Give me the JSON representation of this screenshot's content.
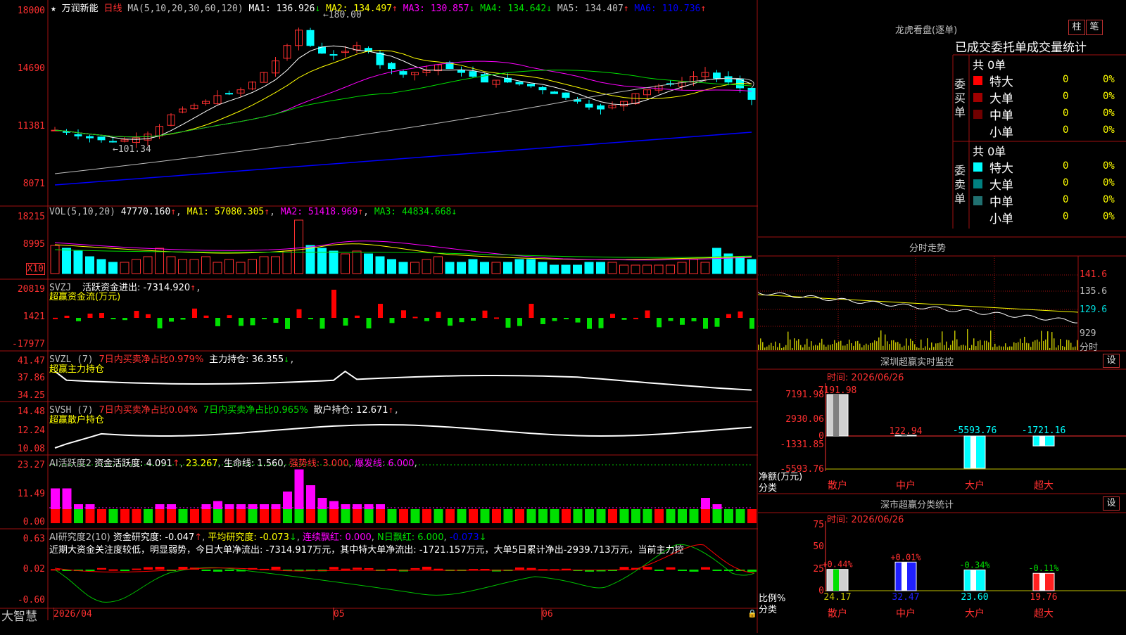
{
  "stock": {
    "name": "万润新能",
    "period": "日线",
    "star": "★",
    "arrow_up": "↑",
    "arrow_down": "↓"
  },
  "main_chart": {
    "ma_label": "MA(5,10,20,30,60,120)",
    "ma": [
      {
        "label": "MA1: 136.926",
        "arrow": "↓",
        "color": "#ffffff"
      },
      {
        "label": "MA2: 134.497",
        "arrow": "↑",
        "color": "#ffff00"
      },
      {
        "label": "MA3: 130.857",
        "arrow": "↓",
        "color": "#ff00ff"
      },
      {
        "label": "MA4: 134.642",
        "arrow": "↓",
        "color": "#00e000"
      },
      {
        "label": "MA5: 134.407",
        "arrow": "↑",
        "color": "#c0c0c0"
      },
      {
        "label": "MA6: 110.736",
        "arrow": "↑",
        "color": "#0000ff"
      }
    ],
    "y_ticks": [
      "18000",
      "14690",
      "11381",
      "8071"
    ],
    "high_marker": "180.00",
    "low_marker": "101.34"
  },
  "volume": {
    "label": "VOL(5,10,20)",
    "value": "47770.160",
    "ma1": "MA1: 57080.305",
    "ma2": "MA2: 51418.969",
    "ma3": "MA3: 44834.668",
    "y_ticks": [
      "18215",
      "8995"
    ],
    "unit": "X10"
  },
  "svzj": {
    "label": "SVZJ",
    "title": "活跃资金进出: -7314.920",
    "sub": "超赢资金流(万元)",
    "y_ticks": [
      "20819",
      "1421",
      "-17977"
    ]
  },
  "svzl": {
    "label": "SVZL (7)",
    "red": "7日内买卖净占比0.979%",
    "text": "主力持仓: 36.355",
    "sub": "超赢主力持仓",
    "y_ticks": [
      "41.47",
      "37.86",
      "34.25"
    ]
  },
  "svsh": {
    "label": "SVSH (7)",
    "red": "7日内买卖净占比0.04%",
    "green": "7日内买卖净占比0.965%",
    "text": "散户持仓: 12.671",
    "sub": "超赢散户持仓",
    "y_ticks": [
      "14.48",
      "12.24",
      "10.08"
    ]
  },
  "ai_active": {
    "label": "AI活跃度2",
    "t1": "资金活跃度: 4.091",
    "t2": "23.267",
    "t3": "生命线: 1.560",
    "t4": "强势线: 3.000",
    "t5": "爆发线: 6.000",
    "y_ticks": [
      "23.27",
      "11.49",
      "0.00"
    ]
  },
  "ai_research": {
    "label": "AI研究度2(10)",
    "t1": "资金研究度: -0.047",
    "t2": "平均研究度: -0.073",
    "t3": "连续飘红: 0.000",
    "t4": "N日飘红: 6.000",
    "t5": "-0.073",
    "comment": "近期大资金关注度较低，明显弱势，今日大单净流出: -7314.917万元，其中特大单净流出: -1721.157万元，大单5日累计净出-2939.713万元，当前主力控",
    "y_ticks": [
      "0.63",
      "0.02",
      "-0.60"
    ]
  },
  "x_axis": {
    "labels": [
      "2026/04",
      "05",
      "06"
    ],
    "brand": "大智慧"
  },
  "dragon_tiger": {
    "title": "龙虎看盘(逐单)",
    "btn1": "柱",
    "btn2": "笔",
    "header": "已成交委托单成交量统计",
    "buy_side": "委买单",
    "sell_side": "委卖单",
    "buy_total": "共 0单",
    "sell_total": "共 0单",
    "buy_rows": [
      {
        "name": "特大",
        "count": "0",
        "pct": "0%",
        "color": "#ff0000"
      },
      {
        "name": "大单",
        "count": "0",
        "pct": "0%",
        "color": "#a00000"
      },
      {
        "name": "中单",
        "count": "0",
        "pct": "0%",
        "color": "#700000"
      },
      {
        "name": "小单",
        "count": "0",
        "pct": "0%",
        "color": "#000000"
      }
    ],
    "sell_rows": [
      {
        "name": "特大",
        "count": "0",
        "pct": "0%",
        "color": "#00ffff"
      },
      {
        "name": "大单",
        "count": "0",
        "pct": "0%",
        "color": "#008080"
      },
      {
        "name": "中单",
        "count": "0",
        "pct": "0%",
        "color": "#207070"
      },
      {
        "name": "小单",
        "count": "0",
        "pct": "0%",
        "color": "#000000"
      }
    ]
  },
  "intraday": {
    "title": "分时走势",
    "y_ticks": [
      "141.6",
      "135.6",
      "129.6"
    ],
    "vol_tick": "929",
    "vol_unit": "分时"
  },
  "sz_monitor": {
    "title": "深圳超赢实时监控",
    "btn": "设",
    "time": "时间: 2026/06/26",
    "y_ticks": [
      "7191.98",
      "2930.06",
      "0",
      "-1331.85",
      "-5593.76"
    ],
    "axis_name": "净额(万元)",
    "axis_cat": "分类",
    "categories": [
      "散户",
      "中户",
      "大户",
      "超大"
    ],
    "values": [
      "7191.98",
      "122.94",
      "-5593.76",
      "-1721.16"
    ]
  },
  "sz_class": {
    "title": "深市超赢分类统计",
    "btn": "设",
    "time": "时间: 2026/06/26",
    "y_ticks": [
      "75",
      "50",
      "25",
      "0"
    ],
    "axis_name": "比例%",
    "axis_cat": "分类",
    "categories": [
      "散户",
      "中户",
      "大户",
      "超大"
    ],
    "values": [
      "24.17",
      "32.47",
      "23.60",
      "19.76"
    ],
    "changes": [
      "+0.44%",
      "+0.01%",
      "-0.34%",
      "-0.11%"
    ]
  }
}
